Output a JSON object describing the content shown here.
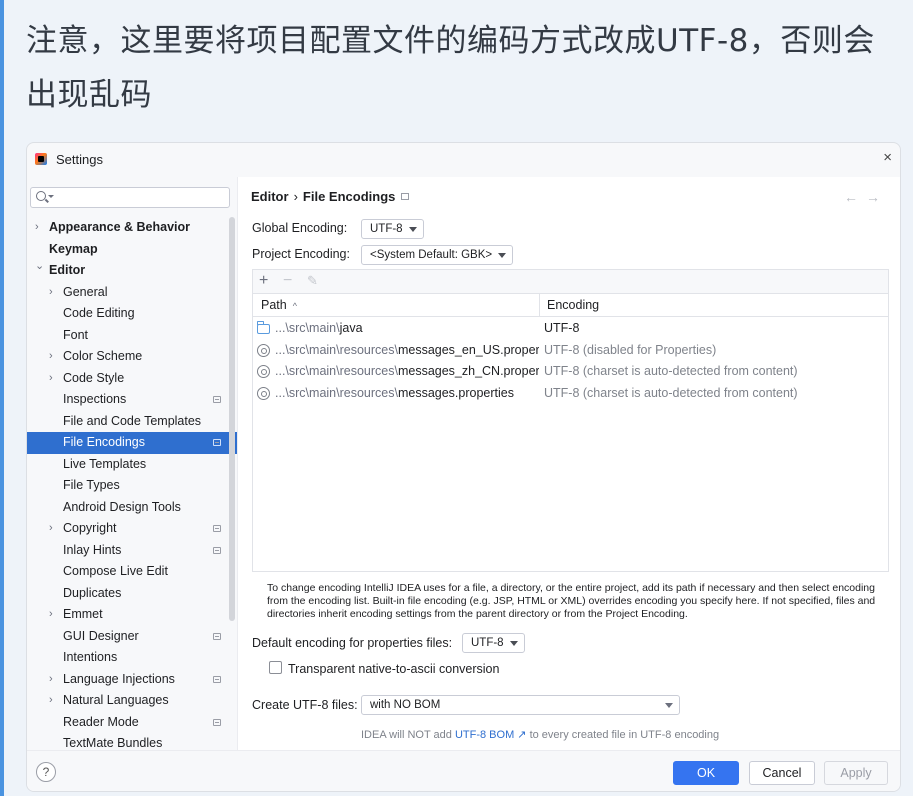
{
  "article": {
    "heading": "注意，这里要将项目配置文件的编码方式改成UTF-8，否则会出现乱码"
  },
  "dialog": {
    "title": "Settings",
    "close_label": "×",
    "search": {
      "value": "",
      "placeholder": ""
    },
    "tree": [
      {
        "label": "Appearance & Behavior",
        "level": 0,
        "chevron": "›",
        "bold": true
      },
      {
        "label": "Keymap",
        "level": 0,
        "chevron": "",
        "bold": true
      },
      {
        "label": "Editor",
        "level": 0,
        "chevron": "⌄",
        "bold": true
      },
      {
        "label": "General",
        "level": 1,
        "chevron": "›"
      },
      {
        "label": "Code Editing",
        "level": 1,
        "chevron": ""
      },
      {
        "label": "Font",
        "level": 1,
        "chevron": ""
      },
      {
        "label": "Color Scheme",
        "level": 1,
        "chevron": "›"
      },
      {
        "label": "Code Style",
        "level": 1,
        "chevron": "›"
      },
      {
        "label": "Inspections",
        "level": 1,
        "chevron": "",
        "proj_icon": true
      },
      {
        "label": "File and Code Templates",
        "level": 1,
        "chevron": ""
      },
      {
        "label": "File Encodings",
        "level": 1,
        "chevron": "",
        "proj_icon": true,
        "selected": true
      },
      {
        "label": "Live Templates",
        "level": 1,
        "chevron": ""
      },
      {
        "label": "File Types",
        "level": 1,
        "chevron": ""
      },
      {
        "label": "Android Design Tools",
        "level": 1,
        "chevron": ""
      },
      {
        "label": "Copyright",
        "level": 1,
        "chevron": "›",
        "proj_icon": true
      },
      {
        "label": "Inlay Hints",
        "level": 1,
        "chevron": "",
        "proj_icon": true
      },
      {
        "label": "Compose Live Edit",
        "level": 1,
        "chevron": ""
      },
      {
        "label": "Duplicates",
        "level": 1,
        "chevron": ""
      },
      {
        "label": "Emmet",
        "level": 1,
        "chevron": "›"
      },
      {
        "label": "GUI Designer",
        "level": 1,
        "chevron": "",
        "proj_icon": true
      },
      {
        "label": "Intentions",
        "level": 1,
        "chevron": ""
      },
      {
        "label": "Language Injections",
        "level": 1,
        "chevron": "›",
        "proj_icon": true
      },
      {
        "label": "Natural Languages",
        "level": 1,
        "chevron": "›"
      },
      {
        "label": "Reader Mode",
        "level": 1,
        "chevron": "",
        "proj_icon": true
      },
      {
        "label": "TextMate Bundles",
        "level": 1,
        "chevron": ""
      }
    ],
    "breadcrumb": {
      "parent": "Editor",
      "separator": "›",
      "current": "File Encodings"
    },
    "nav": {
      "back": "←",
      "forward": "→"
    },
    "global_encoding": {
      "label": "Global Encoding:",
      "value": "UTF-8"
    },
    "project_encoding": {
      "label": "Project Encoding:",
      "value": "<System Default: GBK>"
    },
    "table_toolbar": {
      "add": "+",
      "remove": "−",
      "edit": "✎"
    },
    "table": {
      "columns": {
        "path": "Path",
        "encoding": "Encoding"
      },
      "sort_indicator": "^",
      "rows": [
        {
          "icon": "folder-icon",
          "prefix": "...\\src\\main\\",
          "name": "java",
          "encoding": "UTF-8",
          "muted": false
        },
        {
          "icon": "properties-file-icon",
          "prefix": "...\\src\\main\\resources\\",
          "name": "messages_en_US.propertie",
          "encoding": "UTF-8 (disabled for Properties)",
          "muted": true
        },
        {
          "icon": "properties-file-icon",
          "prefix": "...\\src\\main\\resources\\",
          "name": "messages_zh_CN.properti",
          "encoding": "UTF-8 (charset is auto-detected from content)",
          "muted": true
        },
        {
          "icon": "properties-file-icon",
          "prefix": "...\\src\\main\\resources\\",
          "name": "messages.properties",
          "encoding": "UTF-8 (charset is auto-detected from content)",
          "muted": true
        }
      ]
    },
    "help_text": "To change encoding IntelliJ IDEA uses for a file, a directory, or the entire project, add its path if necessary and then select encoding from the encoding list. Built-in file encoding (e.g. JSP, HTML or XML) overrides encoding you specify here. If not specified, files and directories inherit encoding settings from the parent directory or from the Project Encoding.",
    "properties_encoding": {
      "label": "Default encoding for properties files:",
      "value": "UTF-8"
    },
    "native_to_ascii": {
      "label": "Transparent native-to-ascii conversion",
      "checked": false
    },
    "create_utf8": {
      "label": "Create UTF-8 files:",
      "value": "with NO BOM"
    },
    "bom_hint": {
      "before": "IDEA will NOT add ",
      "link": "UTF-8 BOM ↗",
      "after": " to every created file in UTF-8 encoding"
    },
    "buttons": {
      "help": "?",
      "ok": "OK",
      "cancel": "Cancel",
      "apply": "Apply"
    }
  },
  "colors": {
    "accent": "#3574f0",
    "selection": "#2f6fcf",
    "page_background": "#eef3f9"
  }
}
